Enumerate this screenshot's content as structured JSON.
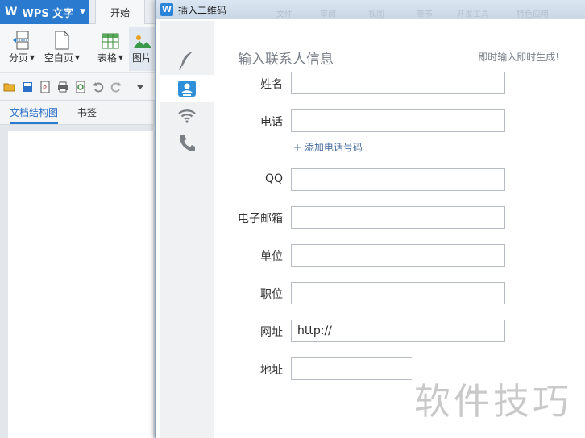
{
  "wps": {
    "app_button": "WPS 文字",
    "tab_home": "开始",
    "ribbon": {
      "page_break": "分页",
      "blank_page": "空白页",
      "table": "表格",
      "picture": "图片"
    },
    "nav_tabs": {
      "outline": "文档结构图",
      "bookmark": "书签"
    },
    "ghost_tabs": [
      "文件",
      "审阅",
      "视图",
      "章节",
      "开发工具",
      "特色应用"
    ]
  },
  "dialog": {
    "title": "插入二维码",
    "title_icon": "W",
    "rail_icons": [
      "feather-icon",
      "contact-card-icon",
      "wifi-icon",
      "phone-icon"
    ],
    "panel_title": "输入联系人信息",
    "panel_hint": "即时输入即时生成!",
    "add_phone": "+ 添加电话号码",
    "fields": {
      "name": {
        "label": "姓名",
        "value": ""
      },
      "phone": {
        "label": "电话",
        "value": ""
      },
      "qq": {
        "label": "QQ",
        "value": ""
      },
      "email": {
        "label": "电子邮箱",
        "value": ""
      },
      "company": {
        "label": "单位",
        "value": ""
      },
      "position": {
        "label": "职位",
        "value": ""
      },
      "website": {
        "label": "网址",
        "value": "http://"
      },
      "address": {
        "label": "地址",
        "value": ""
      }
    }
  },
  "watermark": "软件技巧",
  "colors": {
    "accent": "#2a7bd0",
    "link": "#4a6fa0"
  }
}
